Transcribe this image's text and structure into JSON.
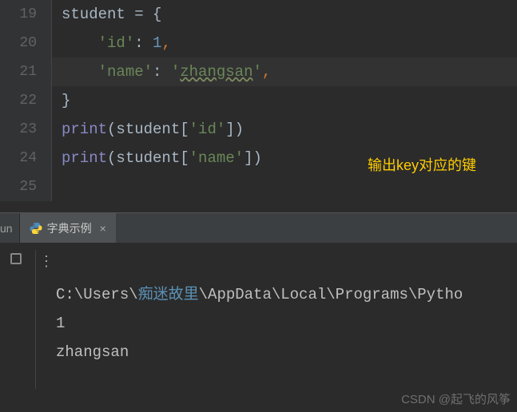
{
  "gutter": {
    "start": 19,
    "count": 7,
    "active": 21
  },
  "code": {
    "l19": {
      "pre": "student ",
      "eq": "= ",
      "brace": "{"
    },
    "l20": {
      "indent": "    ",
      "key": "'id'",
      "colon": ": ",
      "val": "1",
      "comma": ","
    },
    "l21": {
      "indent": "    ",
      "key": "'name'",
      "colon": ": ",
      "q1": "'",
      "val": "zhangsan",
      "q2": "'",
      "comma": ","
    },
    "l22": {
      "brace": "}"
    },
    "l23": {
      "fn": "print",
      "open": "(",
      "obj": "student[",
      "key": "'id'",
      "close1": "]",
      "close2": ")"
    },
    "l24": {
      "fn": "print",
      "open": "(",
      "obj": "student[",
      "key": "'name'",
      "close1": "]",
      "close2": ")"
    }
  },
  "annotation": "输出key对应的键",
  "run": {
    "label": "un",
    "tab_name": "字典示例",
    "tab_close": "×"
  },
  "console": {
    "path_prefix": "C:\\Users\\",
    "path_cn": "痴迷故里",
    "path_suffix": "\\AppData\\Local\\Programs\\Pytho",
    "out1": "1",
    "out2": "zhangsan"
  },
  "watermark": "CSDN @起飞的风筝"
}
